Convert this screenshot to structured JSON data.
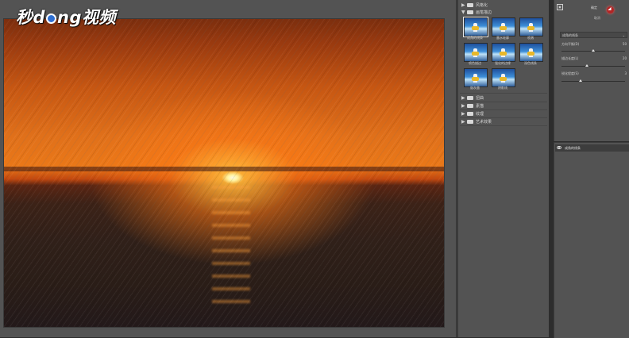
{
  "watermark": {
    "part1": "秒d",
    "part2": "ng视频"
  },
  "gallery": {
    "categories": [
      {
        "label": "风格化",
        "expanded": false
      },
      {
        "label": "画笔描边",
        "expanded": true
      }
    ],
    "thumbs": [
      {
        "label": "成角的线条",
        "selected": true
      },
      {
        "label": "墨水轮廓",
        "selected": false
      },
      {
        "label": "喷溅",
        "selected": false
      },
      {
        "label": "喷色描边",
        "selected": false
      },
      {
        "label": "强化的边缘",
        "selected": false
      },
      {
        "label": "深色线条",
        "selected": false
      },
      {
        "label": "烟灰墨",
        "selected": false
      },
      {
        "label": "阴影线",
        "selected": false
      }
    ],
    "more_categories": [
      "扭曲",
      "素描",
      "纹理",
      "艺术效果"
    ]
  },
  "settings": {
    "collapse_icon": "▣",
    "ok_label": "确定",
    "cancel_label": "取消",
    "filter_selected": "成角的线条",
    "params": [
      {
        "label": "方向平衡(D)",
        "value": "50",
        "fraction": 0.5
      },
      {
        "label": "描边长度(L)",
        "value": "20",
        "fraction": 0.4
      },
      {
        "label": "锐化程度(S)",
        "value": "3",
        "fraction": 0.3
      }
    ]
  },
  "layers": {
    "items": [
      {
        "label": "成角的线条"
      }
    ]
  },
  "colors": {
    "accent_cursor": "#b22525",
    "panel_bg": "#535353"
  }
}
